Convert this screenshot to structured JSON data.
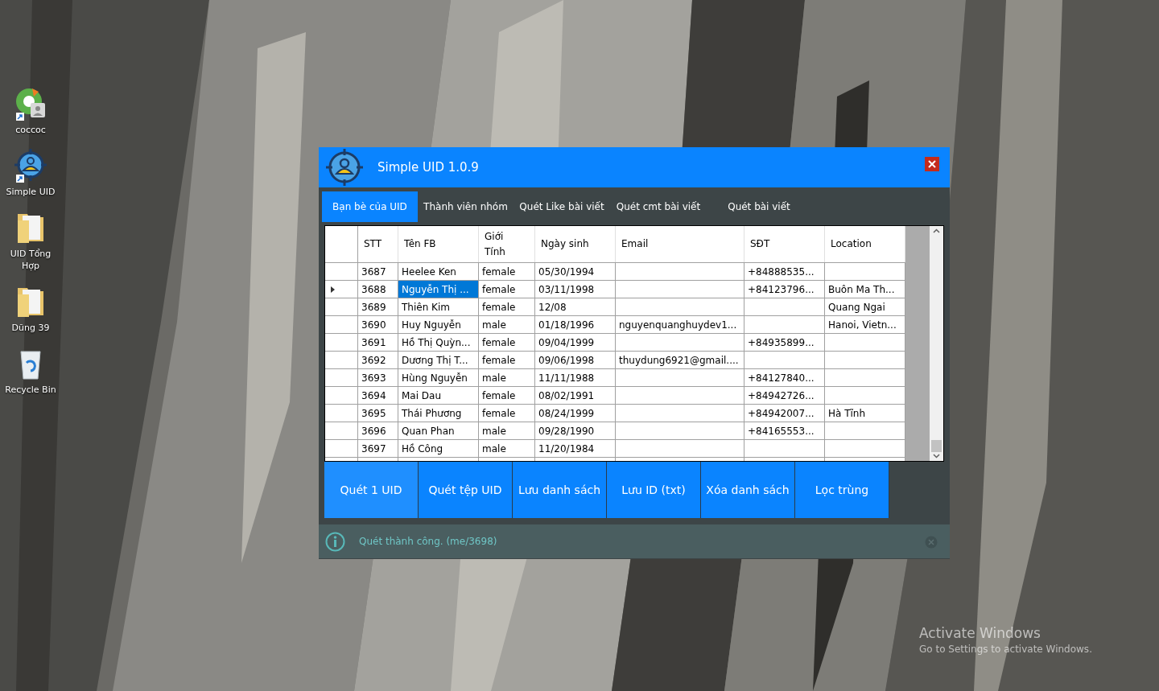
{
  "desktop": {
    "icons": [
      {
        "kind": "browser",
        "label": "coccoc",
        "shortcut": true
      },
      {
        "kind": "target",
        "label": "Simple UID",
        "shortcut": true
      },
      {
        "kind": "folder",
        "label": "UID Tổng Hợp",
        "shortcut": false
      },
      {
        "kind": "folder",
        "label": "Dũng 39",
        "shortcut": false
      },
      {
        "kind": "recycle",
        "label": "Recycle Bin",
        "shortcut": false
      }
    ],
    "activation": {
      "title": "Activate Windows",
      "subtitle": "Go to Settings to activate Windows."
    }
  },
  "window": {
    "title": "Simple UID 1.0.9"
  },
  "tabs": [
    {
      "label": "Bạn bè của UID",
      "selected": true
    },
    {
      "label": "Thành viên nhóm",
      "selected": false
    },
    {
      "label": "Quét Like bài viết",
      "selected": false
    },
    {
      "label": "Quét cmt bài viết",
      "selected": false
    },
    {
      "label": "Quét bài viết",
      "selected": false
    }
  ],
  "table": {
    "columns": [
      "STT",
      "Tên FB",
      "Giới Tính",
      "Ngày sinh",
      "Email",
      "SĐT",
      "Location"
    ],
    "rows": [
      {
        "selected": false,
        "cells": [
          "3687",
          "Heelee Ken",
          "female",
          "05/30/1994",
          "",
          "+84888535...",
          ""
        ]
      },
      {
        "selected": true,
        "cells": [
          "3688",
          "Nguyễn Thị ...",
          "female",
          "03/11/1998",
          "",
          "+84123796...",
          "Buôn Ma Th..."
        ]
      },
      {
        "selected": false,
        "cells": [
          "3689",
          "Thiên Kim",
          "female",
          "12/08",
          "",
          "",
          "Quang Ngai"
        ]
      },
      {
        "selected": false,
        "cells": [
          "3690",
          "Huy Nguyễn",
          "male",
          "01/18/1996",
          "nguyenquanghuydev1...",
          "",
          "Hanoi, Vietn..."
        ]
      },
      {
        "selected": false,
        "cells": [
          "3691",
          "Hồ Thị Quỳn...",
          "female",
          "09/04/1999",
          "",
          "+84935899...",
          ""
        ]
      },
      {
        "selected": false,
        "cells": [
          "3692",
          "Dương Thị T...",
          "female",
          "09/06/1998",
          "thuydung6921@gmail....",
          "",
          ""
        ]
      },
      {
        "selected": false,
        "cells": [
          "3693",
          "Hùng Nguyễn",
          "male",
          "11/11/1988",
          "",
          "+84127840...",
          ""
        ]
      },
      {
        "selected": false,
        "cells": [
          "3694",
          "Mai Dau",
          "female",
          "08/02/1991",
          "",
          "+84942726...",
          ""
        ]
      },
      {
        "selected": false,
        "cells": [
          "3695",
          "Thái Phương",
          "female",
          "08/24/1999",
          "",
          "+84942007...",
          "Hà Tĩnh"
        ]
      },
      {
        "selected": false,
        "cells": [
          "3696",
          "Quan Phan",
          "male",
          "09/28/1990",
          "",
          "+84165553...",
          ""
        ]
      },
      {
        "selected": false,
        "cells": [
          "3697",
          "Hồ Công",
          "male",
          "11/20/1984",
          "",
          "",
          ""
        ]
      }
    ]
  },
  "buttons": [
    {
      "label": "Quét 1 UID",
      "hovered": true
    },
    {
      "label": "Quét tệp UID",
      "hovered": false
    },
    {
      "label": "Lưu danh sách",
      "hovered": false
    },
    {
      "label": "Lưu ID (txt)",
      "hovered": false
    },
    {
      "label": "Xóa danh sách",
      "hovered": false
    },
    {
      "label": "Lọc trùng",
      "hovered": false
    }
  ],
  "status_bar": {
    "message": "Quét thành công. (me/3698)"
  }
}
